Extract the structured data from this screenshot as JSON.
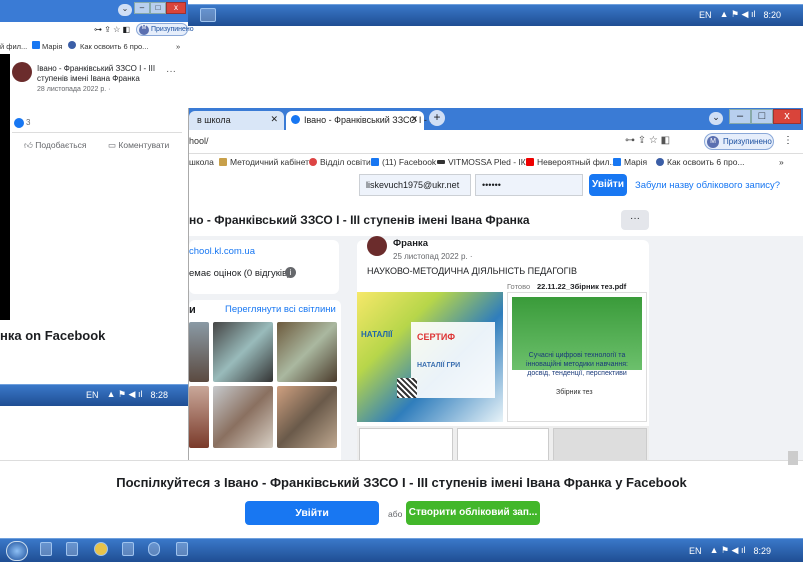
{
  "taskbar_top": {
    "lang": "EN",
    "time": "8:20"
  },
  "taskbar_mid": {
    "lang": "EN",
    "time": "8:28"
  },
  "taskbar_bottom": {
    "lang": "EN",
    "time": "8:29"
  },
  "back_window": {
    "bookmarks": [
      "й фил...",
      "Марія",
      "Как освоить 6 про..."
    ],
    "profile_label": "Призупинено",
    "profile_initial": "M",
    "post_author": "Івано - Франківський ЗЗСО І - ІІІ ступенів імені Івана Франка",
    "post_date": "28 листопада 2022 р. ·",
    "reactions_count": "3",
    "like_label": "Подобається",
    "comment_label": "Коментувати",
    "facebook_caption": "нка on Facebook"
  },
  "front_window": {
    "tabs": [
      {
        "label": "в школа"
      },
      {
        "label": "Івано - Франківський ЗЗСО І - ІІ"
      }
    ],
    "url": "hool/",
    "profile_label": "Призупинено",
    "profile_initial": "M",
    "bookmarks": [
      "школа",
      "Методичний кабінет",
      "Відділ освіти",
      "(11) Facebook",
      "VITMOSSA Pled - ІК...",
      "Невероятный фил...",
      "Марія",
      "Как освоить 6 про..."
    ],
    "login": {
      "email_value": "liskevuch1975@ukr.net",
      "password_value": "••••••",
      "login_button": "Увійти",
      "forgot_link": "Забули назву облікового запису?"
    },
    "page_title": "но - Франківський ЗЗСО І - ІІІ ступенів імені Івана Франка",
    "more_button": "···",
    "website": "chool.kl.com.ua",
    "rating_text": "емає оцінок (0 відгуків)",
    "photos_header": "и",
    "see_all_photos": "Переглянути всі світлини",
    "post": {
      "author_partial": "Франка",
      "date": "25 листопад 2022 р. ·",
      "text": "НАУКОВО-МЕТОДИЧНА ДІЯЛЬНІСТЬ ПЕДАГОГІВ",
      "ready_label": "Готово",
      "file_name": "22.11.22_Збірник тез.pdf",
      "doc_title": "Сучасні цифрові технології та інноваційні методики навчання: досвід, тенденції, перспективи",
      "doc_subtitle": "Збірник тез",
      "certificate_label": "СЕРТИФ",
      "certificate_name": "НАТАЛІЇ ГРИ",
      "natalii_label": "НАТАЛІЇ"
    }
  },
  "banner": {
    "title": "Поспілкуйтеся з Івано - Франківський ЗЗСО І - ІІІ ступенів імені Івана Франка у Facebook",
    "login_button": "Увійти",
    "or_label": "або",
    "create_button": "Створити обліковий зап..."
  },
  "colors": {
    "fb_blue": "#1877f2",
    "fb_green": "#42b72a",
    "taskbar": "#2a5fae"
  }
}
